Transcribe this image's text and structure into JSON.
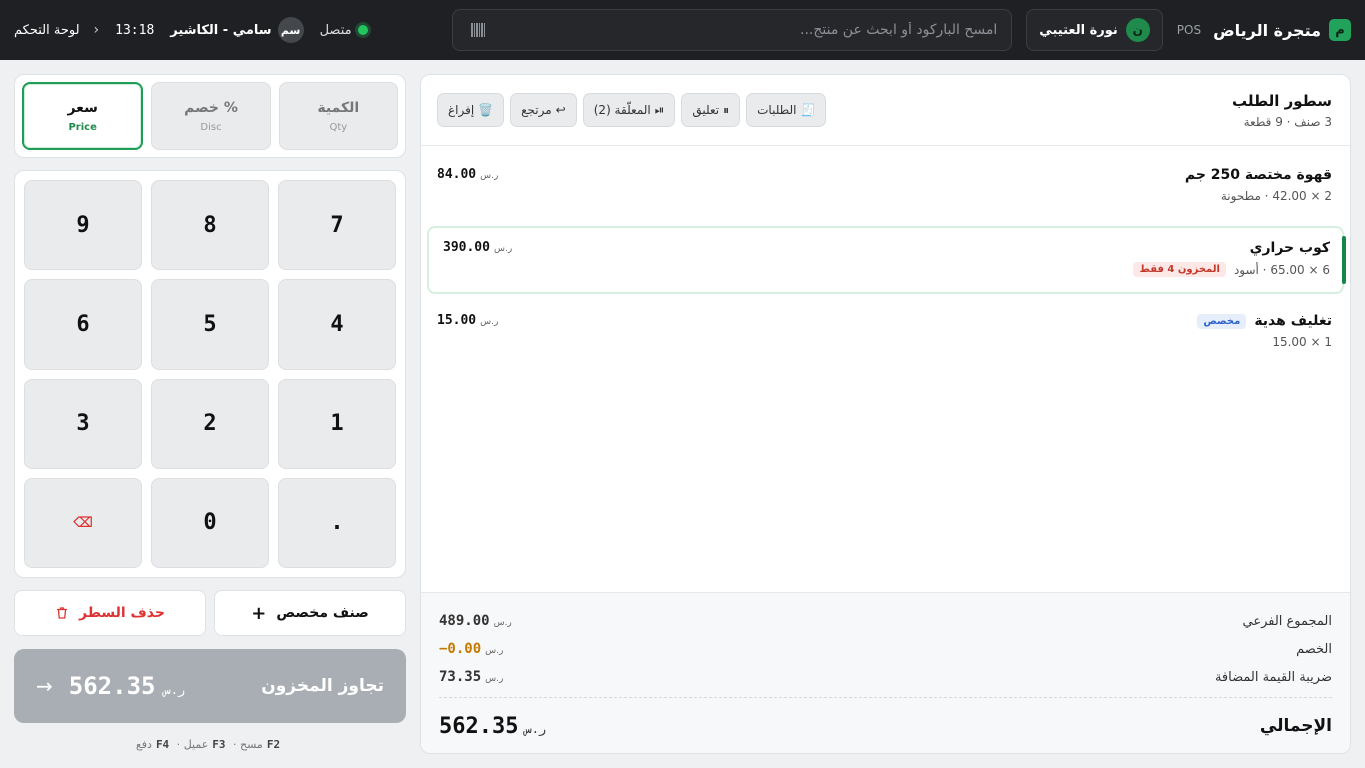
{
  "header": {
    "brand_badge": "م",
    "brand_name": "متجرة الرياض",
    "brand_tag": "POS",
    "customer_avatar": "ن",
    "customer_name": "نورة العتيبي",
    "search_placeholder": "امسح الباركود أو ابحث عن منتج...",
    "status": "متصل",
    "cashier_avatar": "سم",
    "cashier": "سامي - الكاشير",
    "time": "13:18",
    "dashboard": "لوحة التحكم"
  },
  "order": {
    "title": "سطور الطلب",
    "subtitle": "3 صنف · 9 قطعة",
    "actions": [
      {
        "icon": "🧾",
        "label": "الطلبات"
      },
      {
        "icon": "⏸",
        "label": "تعليق"
      },
      {
        "icon": "⏯",
        "label": "المعلّقة (2)"
      },
      {
        "icon": "↩",
        "label": "مرتجع"
      },
      {
        "icon": "🗑️",
        "label": "إفراغ"
      }
    ],
    "lines": [
      {
        "name": "قهوة مختصة 250 جم",
        "meta": "2 × 42.00 · مطحونة",
        "price": "84.00",
        "currency": "ر.س"
      },
      {
        "name": "كوب حراري",
        "meta": "6 × 65.00 · أسود",
        "badge": "المخزون 4 فقط",
        "price": "390.00",
        "currency": "ر.س"
      },
      {
        "name": "تغليف هدية",
        "badge": "مخصص",
        "meta": "1 × 15.00",
        "price": "15.00",
        "currency": "ر.س"
      }
    ]
  },
  "totals": {
    "subtotal_label": "المجموع الفرعي",
    "subtotal": "489.00",
    "discount_label": "الخصم",
    "discount": "−0.00",
    "vat_label": "ضريبة القيمة المضافة",
    "vat": "73.35",
    "currency": "ر.س",
    "grand_label": "الإجمالي",
    "grand": "562.35"
  },
  "modes": [
    {
      "ar": "الكمية",
      "en": "Qty"
    },
    {
      "ar": "خصم %",
      "en": "Disc"
    },
    {
      "ar": "سعر",
      "en": "Price"
    }
  ],
  "keypad": [
    "7",
    "8",
    "9",
    "4",
    "5",
    "6",
    "1",
    "2",
    "3",
    ".",
    "0",
    "⌫"
  ],
  "buttons": {
    "custom_item": "صنف مخصص",
    "delete_line": "حذف السطر"
  },
  "pay": {
    "label": "تجاوز المخزون",
    "amount": "562.35",
    "currency": "ر.س"
  },
  "shortcuts": [
    {
      "key": "F2",
      "label": "مسح"
    },
    {
      "key": "F3",
      "label": "عميل"
    },
    {
      "key": "F4",
      "label": "دفع"
    }
  ],
  "colors": {
    "accent": "#1f9d55",
    "topbar": "#1e2023",
    "danger": "#d33333",
    "pay_disabled": "#a9aeb4"
  }
}
